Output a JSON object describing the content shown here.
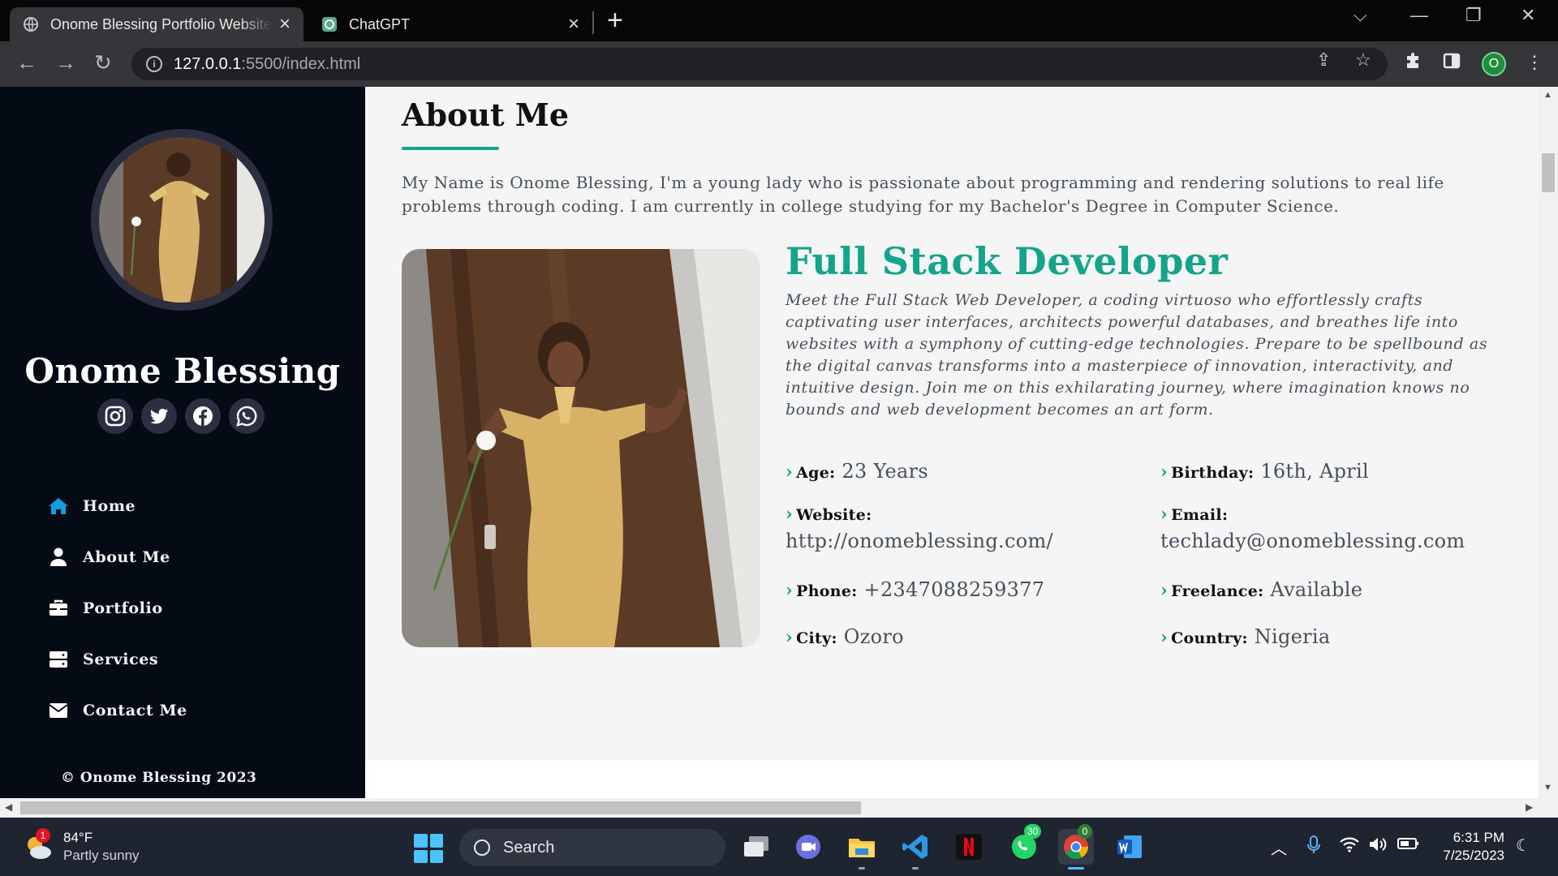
{
  "browser": {
    "tabs": [
      {
        "title": "Onome Blessing Portfolio Website",
        "active": true
      },
      {
        "title": "ChatGPT",
        "active": false
      }
    ],
    "url_host": "127.0.0.1",
    "url_path": ":5500/index.html",
    "profile_initial": "O"
  },
  "sidebar": {
    "name": "Onome Blessing",
    "socials": [
      "instagram",
      "twitter",
      "facebook",
      "whatsapp"
    ],
    "nav": [
      {
        "label": "Home",
        "icon": "home-icon",
        "active": true
      },
      {
        "label": "About Me",
        "icon": "user-icon",
        "active": false
      },
      {
        "label": "Portfolio",
        "icon": "briefcase-icon",
        "active": false
      },
      {
        "label": "Services",
        "icon": "server-icon",
        "active": false
      },
      {
        "label": "Contact Me",
        "icon": "envelope-icon",
        "active": false
      }
    ],
    "copyright": "© Onome Blessing 2023"
  },
  "about": {
    "title": "About Me",
    "intro": "My Name is Onome Blessing, I'm a young lady who is passionate about programming and rendering solutions to real life problems through coding. I am currently in college studying for my Bachelor's Degree in Computer Science.",
    "role": "Full Stack Developer",
    "role_description": "Meet the Full Stack Web Developer, a coding virtuoso who effortlessly crafts captivating user interfaces, architects powerful databases, and breathes life into websites with a symphony of cutting-edge technologies. Prepare to be spellbound as the digital canvas transforms into a masterpiece of innovation, interactivity, and intuitive design. Join me on this exhilarating journey, where imagination knows no bounds and web development becomes an art form.",
    "facts": {
      "age": {
        "label": "Age:",
        "value": "23 Years"
      },
      "birthday": {
        "label": "Birthday:",
        "value": "16th, April"
      },
      "website": {
        "label": "Website:",
        "value": "http://onomeblessing.com/"
      },
      "email": {
        "label": "Email:",
        "value": "techlady@onomeblessing.com"
      },
      "phone": {
        "label": "Phone:",
        "value": "+2347088259377"
      },
      "freelance": {
        "label": "Freelance:",
        "value": "Available"
      },
      "city": {
        "label": "City:",
        "value": "Ozoro"
      },
      "country": {
        "label": "Country:",
        "value": "Nigeria"
      }
    }
  },
  "colors": {
    "accent": "#14a38b",
    "sidebar_bg": "#040b14",
    "nav_active_icon": "#149ddd"
  },
  "taskbar": {
    "weather_temp": "84°F",
    "weather_desc": "Partly sunny",
    "weather_badge": "1",
    "search_label": "Search",
    "whatsapp_badge": "30",
    "chrome_badge": "0",
    "time": "6:31 PM",
    "date": "7/25/2023"
  }
}
